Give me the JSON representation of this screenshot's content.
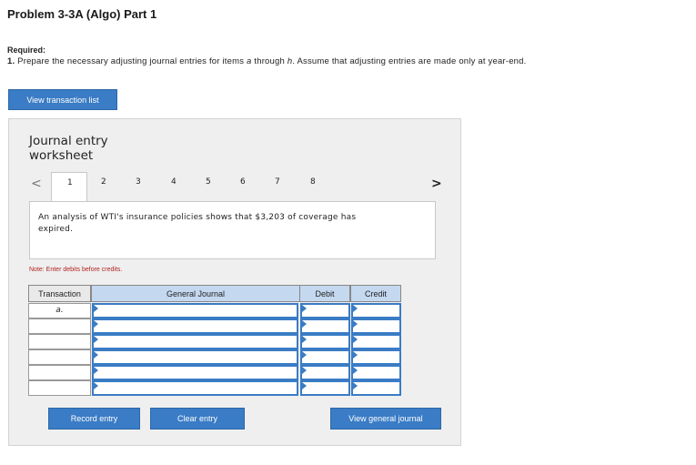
{
  "header": {
    "title": "Problem 3-3A (Algo) Part 1"
  },
  "requirement": {
    "label": "Required:",
    "number": "1.",
    "text_before": "Prepare the necessary adjusting journal entries for items ",
    "item_a": "a",
    "text_mid": " through ",
    "item_h": "h",
    "text_after": ". Assume that adjusting entries are made only at year-end."
  },
  "buttons": {
    "view_transaction_list": "View transaction list",
    "record_entry": "Record entry",
    "clear_entry": "Clear entry",
    "view_general_journal": "View general journal"
  },
  "worksheet": {
    "title_line1": "Journal entry",
    "title_line2": "worksheet",
    "prev_icon": "chevron-left-icon",
    "next_icon": "chevron-right-icon",
    "tabs": [
      "1",
      "2",
      "3",
      "4",
      "5",
      "6",
      "7",
      "8"
    ],
    "active_tab": "1",
    "description": "An analysis of WTI's insurance policies shows that $3,203 of coverage has expired.",
    "note": "Note: Enter debits before credits."
  },
  "journal_table": {
    "headers": {
      "transaction": "Transaction",
      "general_journal": "General Journal",
      "debit": "Debit",
      "credit": "Credit"
    },
    "rows": [
      {
        "transaction": "a."
      },
      {
        "transaction": ""
      },
      {
        "transaction": ""
      },
      {
        "transaction": ""
      },
      {
        "transaction": ""
      },
      {
        "transaction": ""
      }
    ]
  },
  "colors": {
    "accent": "#3a7cc5",
    "header_blue": "#c4d8ef",
    "note_red": "#b22222",
    "panel_bg": "#efefef"
  }
}
